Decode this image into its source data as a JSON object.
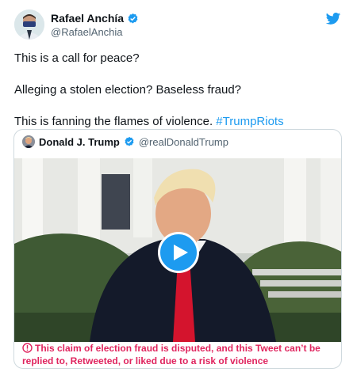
{
  "author": {
    "display_name": "Rafael Anchía",
    "handle": "@RafaelAnchia"
  },
  "tweet": {
    "line1": "This is a call for peace?",
    "line2": "Alleging a stolen election? Baseless fraud?",
    "line3_text": "This is fanning the flames of violence. ",
    "hashtag": "#TrumpRiots"
  },
  "quoted_tweet": {
    "display_name": "Donald J. Trump",
    "handle": "@realDonaldTrump",
    "warning": "This claim of election fraud is disputed, and this Tweet can’t be replied to, Retweeted, or liked due to a risk of violence"
  },
  "icons": {
    "brand": "twitter-bird-icon",
    "verified": "verified-badge-icon",
    "play": "play-icon",
    "warning": "warning-circle-icon"
  },
  "colors": {
    "accent": "#1d9bf0",
    "warning": "#e0245e",
    "text": "#0f1419",
    "muted": "#536471"
  }
}
